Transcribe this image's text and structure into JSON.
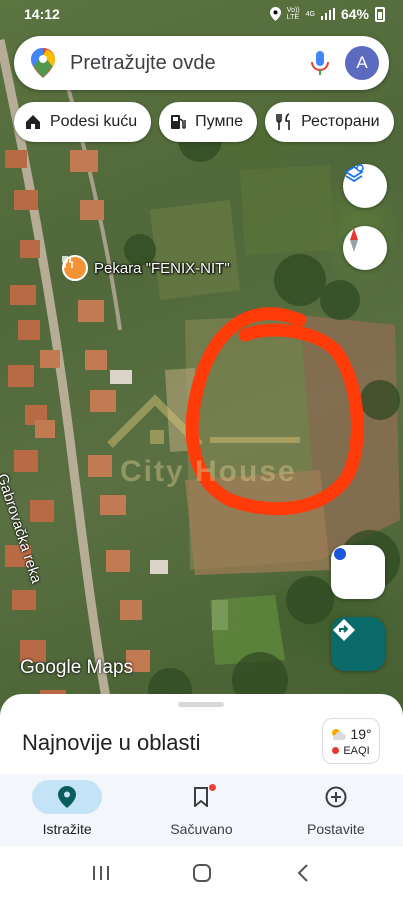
{
  "status_bar": {
    "time": "14:12",
    "network_top": "Vo))",
    "network_bottom": "LTE",
    "network_type": "4G",
    "battery": "64%"
  },
  "search": {
    "placeholder": "Pretražujte ovde",
    "avatar_letter": "A"
  },
  "chips": [
    {
      "label": "Podesi kuću",
      "icon": "home-icon"
    },
    {
      "label": "Пумпе",
      "icon": "gas-station-icon"
    },
    {
      "label": "Ресторани",
      "icon": "restaurant-icon"
    }
  ],
  "map": {
    "place_name": "Pekara \"FENIX-NIT\"",
    "street_name": "Gabrovačka reka",
    "logo": "Google Maps",
    "watermark": "City House"
  },
  "sheet": {
    "title": "Najnovije u oblasti",
    "weather_temp": "19°",
    "weather_aqi": "EAQI"
  },
  "bottom_nav": [
    {
      "label": "Istražite",
      "icon": "explore-pin-icon",
      "active": true
    },
    {
      "label": "Sačuvano",
      "icon": "bookmark-icon",
      "active": false
    },
    {
      "label": "Postavite",
      "icon": "add-circle-icon",
      "active": false
    }
  ],
  "colors": {
    "accent": "#0b6a6a",
    "annotation": "#ff3b0a",
    "active_nav": "#c5e3f6"
  }
}
